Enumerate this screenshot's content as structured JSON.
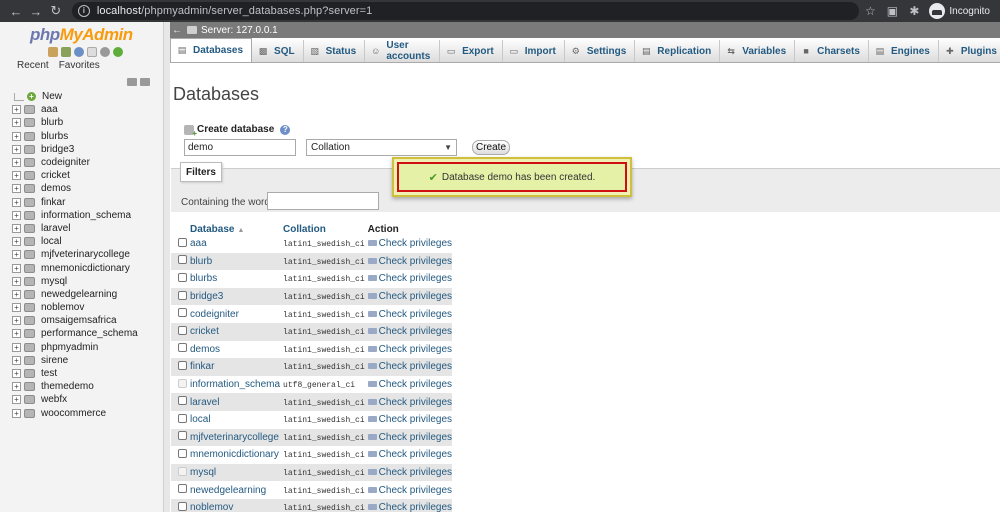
{
  "browser": {
    "url_host": "localhost",
    "url_path": "/phpmyadmin/server_databases.php?server=1",
    "profile_label": "Incognito"
  },
  "nav": {
    "logo_php": "php",
    "logo_my": "My",
    "logo_admin": "Admin",
    "tab_recent": "Recent",
    "tab_favorites": "Favorites",
    "new_label": "New",
    "databases": [
      "aaa",
      "blurb",
      "blurbs",
      "bridge3",
      "codeigniter",
      "cricket",
      "demos",
      "finkar",
      "information_schema",
      "laravel",
      "local",
      "mjfveterinarycollege",
      "mnemonicdictionary",
      "mysql",
      "newedgelearning",
      "noblemov",
      "omsaigemsafrica",
      "performance_schema",
      "phpmyadmin",
      "sirene",
      "test",
      "themedemo",
      "webfx",
      "woocommerce"
    ]
  },
  "server_strip": {
    "label": "Server: 127.0.0.1"
  },
  "menu": {
    "tabs": [
      "Databases",
      "SQL",
      "Status",
      "User accounts",
      "Export",
      "Import",
      "Settings",
      "Replication",
      "Variables",
      "Charsets",
      "Engines",
      "Plugins"
    ]
  },
  "main": {
    "title": "Databases",
    "create_label": "Create database",
    "db_name_value": "demo",
    "collation_value": "Collation",
    "create_button": "Create",
    "filters_label": "Filters",
    "filter_label": "Containing the word:",
    "notice_text": "Database demo has been created.",
    "table_headers": {
      "database": "Database",
      "collation": "Collation",
      "action": "Action"
    },
    "rows": [
      {
        "name": "aaa",
        "collation": "latin1_swedish_ci",
        "action": "Check privileges"
      },
      {
        "name": "blurb",
        "collation": "latin1_swedish_ci",
        "action": "Check privileges"
      },
      {
        "name": "blurbs",
        "collation": "latin1_swedish_ci",
        "action": "Check privileges"
      },
      {
        "name": "bridge3",
        "collation": "latin1_swedish_ci",
        "action": "Check privileges"
      },
      {
        "name": "codeigniter",
        "collation": "latin1_swedish_ci",
        "action": "Check privileges"
      },
      {
        "name": "cricket",
        "collation": "latin1_swedish_ci",
        "action": "Check privileges"
      },
      {
        "name": "demos",
        "collation": "latin1_swedish_ci",
        "action": "Check privileges"
      },
      {
        "name": "finkar",
        "collation": "latin1_swedish_ci",
        "action": "Check privileges"
      },
      {
        "name": "information_schema",
        "collation": "utf8_general_ci",
        "action": "Check privileges"
      },
      {
        "name": "laravel",
        "collation": "latin1_swedish_ci",
        "action": "Check privileges"
      },
      {
        "name": "local",
        "collation": "latin1_swedish_ci",
        "action": "Check privileges"
      },
      {
        "name": "mjfveterinarycollege",
        "collation": "latin1_swedish_ci",
        "action": "Check privileges"
      },
      {
        "name": "mnemonicdictionary",
        "collation": "latin1_swedish_ci",
        "action": "Check privileges"
      },
      {
        "name": "mysql",
        "collation": "latin1_swedish_ci",
        "action": "Check privileges"
      },
      {
        "name": "newedgelearning",
        "collation": "latin1_swedish_ci",
        "action": "Check privileges"
      },
      {
        "name": "noblemov",
        "collation": "latin1_swedish_ci",
        "action": "Check privileges"
      }
    ]
  }
}
